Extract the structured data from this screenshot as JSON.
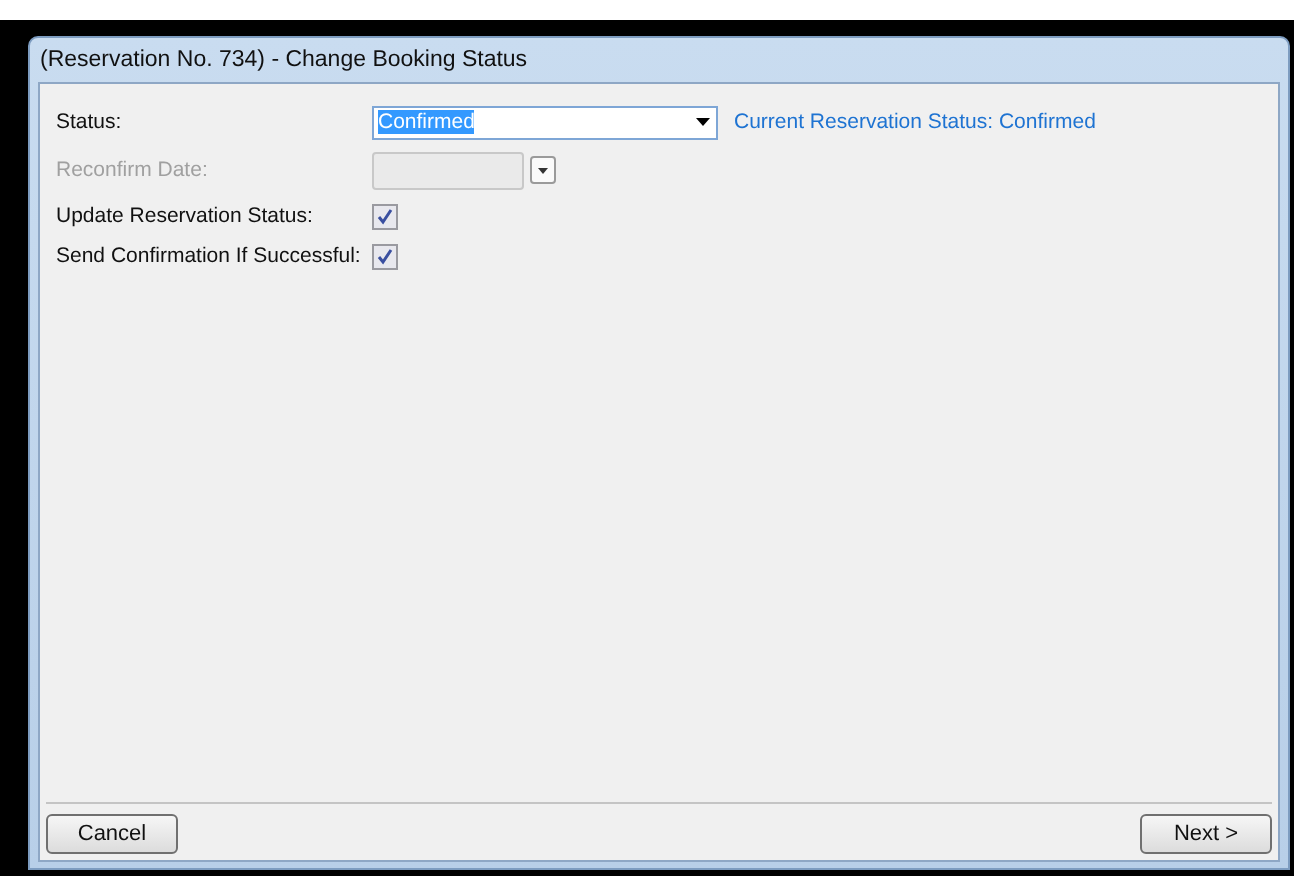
{
  "window": {
    "title": "(Reservation No. 734) - Change Booking Status"
  },
  "fields": [
    {
      "kind": "combo",
      "label": "Status:",
      "value": "Confirmed",
      "note": "Current Reservation Status: Confirmed"
    },
    {
      "kind": "date",
      "label": "Reconfirm Date:",
      "disabled": true
    },
    {
      "kind": "checkbox",
      "label": "Update Reservation Status:",
      "checked": true
    },
    {
      "kind": "checkbox",
      "label": "Send Confirmation If Successful:",
      "checked": true
    }
  ],
  "buttons": [
    {
      "label": "Cancel"
    },
    {
      "label": "Next >"
    }
  ]
}
